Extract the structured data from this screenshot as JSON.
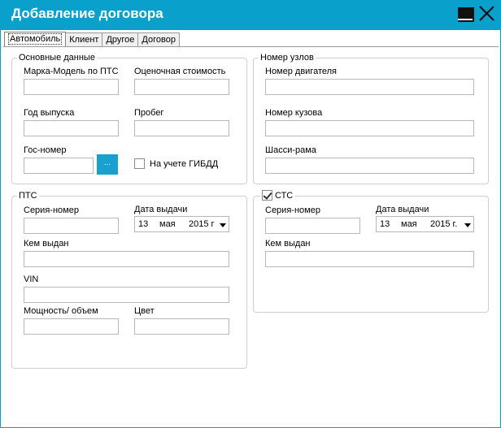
{
  "window": {
    "title": "Добавление договора",
    "accent_color": "#0aa0cc"
  },
  "tabs": [
    {
      "label": "Автомобиль",
      "active": true
    },
    {
      "label": "Клиент",
      "active": false
    },
    {
      "label": "Другое",
      "active": false
    },
    {
      "label": "Договор",
      "active": false
    }
  ],
  "main_data": {
    "title": "Основные данные",
    "model_label": "Марка-Модель по ПТС",
    "model_value": "",
    "valuation_label": "Оценочная стоимость",
    "valuation_value": "",
    "year_label": "Год выпуска",
    "year_value": "",
    "mileage_label": "Пробег",
    "mileage_value": "",
    "plate_label": "Гос-номер",
    "plate_value": "",
    "plate_button": "...",
    "gibdd_label": "На учете ГИБДД",
    "gibdd_checked": false
  },
  "units": {
    "title": "Номер узлов",
    "engine_label": "Номер двигателя",
    "engine_value": "",
    "body_label": "Номер кузова",
    "body_value": "",
    "chassis_label": "Шасси-рама",
    "chassis_value": ""
  },
  "pts": {
    "title": "ПТС",
    "series_label": "Серия-номер",
    "series_value": "",
    "date_label": "Дата выдачи",
    "date_day": "13",
    "date_month": "мая",
    "date_year": "2015 г",
    "issued_by_label": "Кем выдан",
    "issued_by_value": "",
    "vin_label": "VIN",
    "vin_value": "",
    "power_label": "Мощность/ объем",
    "power_value": "",
    "color_label": "Цвет",
    "color_value": ""
  },
  "sts": {
    "title": "СТС",
    "enabled": true,
    "series_label": "Серия-номер",
    "series_value": "",
    "date_label": "Дата выдачи",
    "date_day": "13",
    "date_month": "мая",
    "date_year": "2015 г.",
    "issued_by_label": "Кем выдан",
    "issued_by_value": ""
  }
}
